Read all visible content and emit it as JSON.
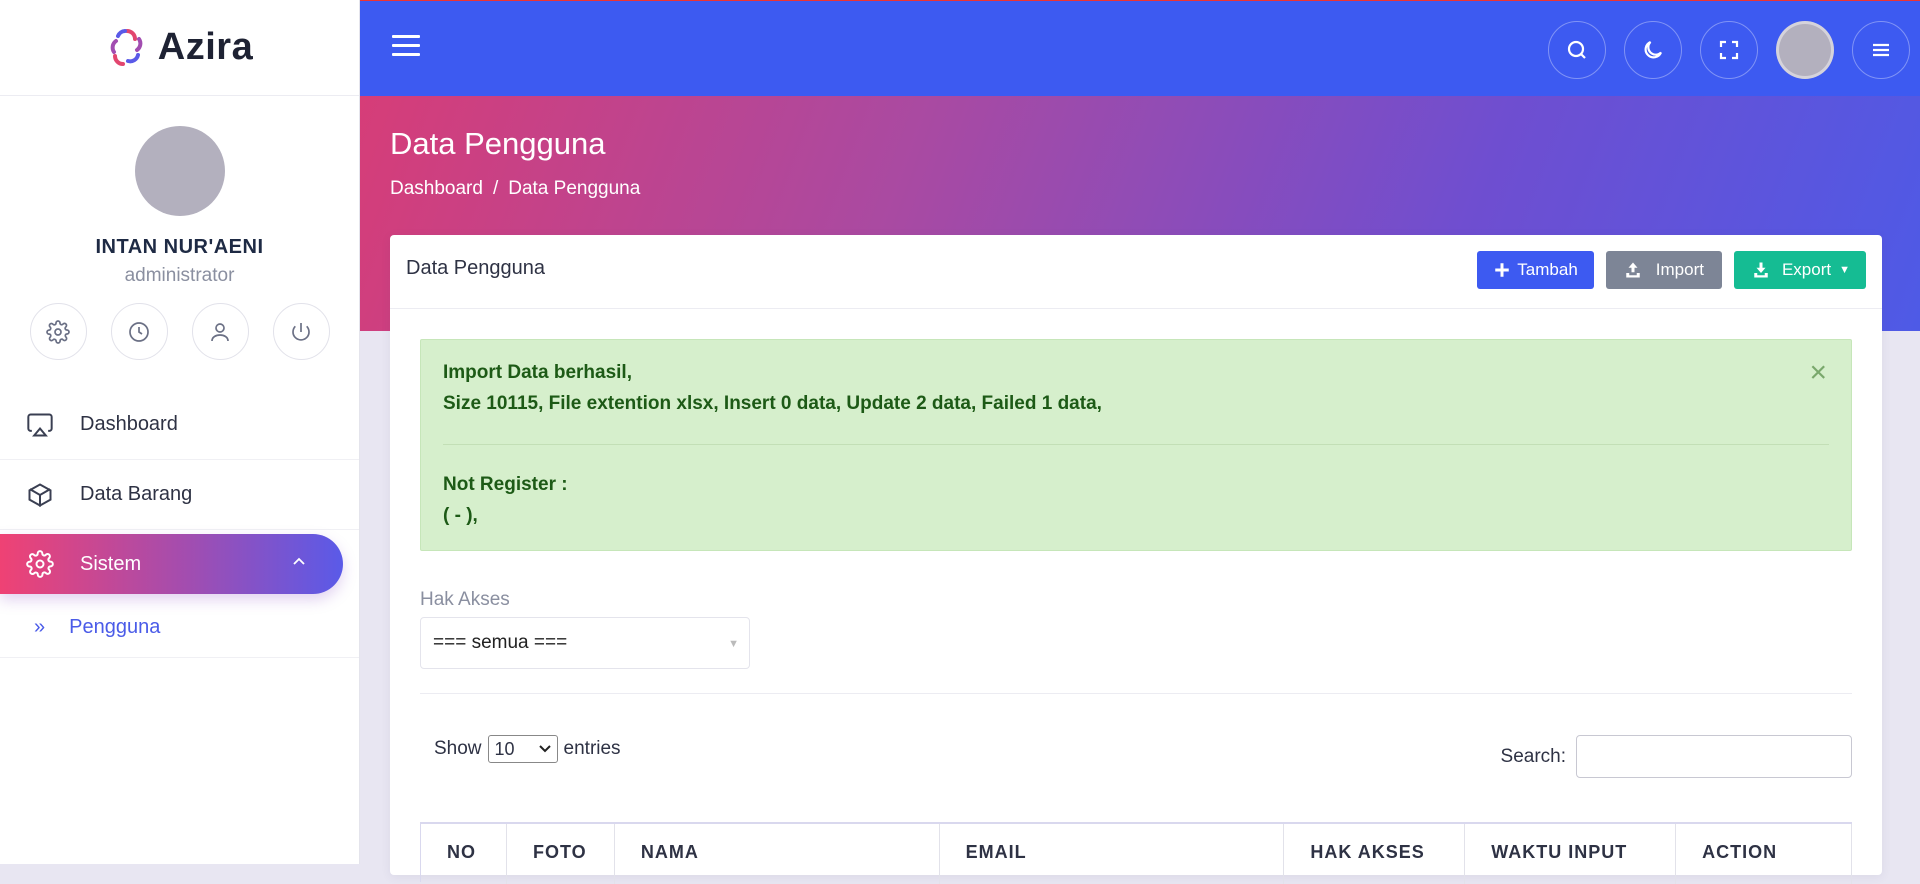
{
  "brand": {
    "name": "Azira"
  },
  "user": {
    "name": "INTAN NUR'AENI",
    "role": "administrator"
  },
  "quick_actions": [
    "gear-icon",
    "clock-icon",
    "user-icon",
    "power-icon"
  ],
  "menu": {
    "items": [
      {
        "label": "Dashboard",
        "icon": "monitor-icon"
      },
      {
        "label": "Data Barang",
        "icon": "box-icon"
      },
      {
        "label": "Sistem",
        "icon": "gear-icon",
        "active": true
      }
    ],
    "submenu": [
      {
        "label": "Pengguna",
        "prefix": "»"
      }
    ]
  },
  "topbar": {
    "icons": [
      "search-icon",
      "moon-icon",
      "fullscreen-icon",
      "avatar",
      "menu-icon"
    ]
  },
  "header": {
    "title": "Data Pengguna",
    "breadcrumb": [
      "Dashboard",
      "Data Pengguna"
    ],
    "breadcrumb_sep": "/"
  },
  "card": {
    "title": "Data Pengguna",
    "buttons": {
      "add": "Tambah",
      "import": "Import",
      "export": "Export"
    }
  },
  "alert": {
    "line1": "Import Data berhasil,",
    "line2": "Size 10115, File extention xlsx, Insert 0 data, Update 2 data, Failed 1 data,",
    "line3": "Not Register :",
    "line4": "( - ),",
    "close": "×"
  },
  "filter": {
    "label": "Hak Akses",
    "value": "=== semua ==="
  },
  "table_controls": {
    "show": "Show",
    "entries_value": "10",
    "entries": "entries",
    "search_label": "Search:"
  },
  "table": {
    "columns": [
      "NO",
      "FOTO",
      "NAMA",
      "EMAIL",
      "HAK AKSES",
      "WAKTU INPUT",
      "ACTION"
    ]
  },
  "colors": {
    "primary": "#3d5af1",
    "success": "#15bc93",
    "secondary": "#7d8596",
    "alert_bg": "#d6efcc"
  }
}
